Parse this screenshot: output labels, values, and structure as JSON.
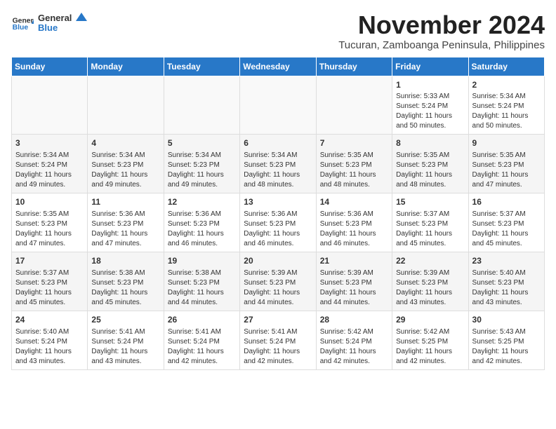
{
  "logo": {
    "line1": "General",
    "line2": "Blue"
  },
  "title": "November 2024",
  "location": "Tucuran, Zamboanga Peninsula, Philippines",
  "weekdays": [
    "Sunday",
    "Monday",
    "Tuesday",
    "Wednesday",
    "Thursday",
    "Friday",
    "Saturday"
  ],
  "weeks": [
    [
      {
        "day": "",
        "content": ""
      },
      {
        "day": "",
        "content": ""
      },
      {
        "day": "",
        "content": ""
      },
      {
        "day": "",
        "content": ""
      },
      {
        "day": "",
        "content": ""
      },
      {
        "day": "1",
        "content": "Sunrise: 5:33 AM\nSunset: 5:24 PM\nDaylight: 11 hours and 50 minutes."
      },
      {
        "day": "2",
        "content": "Sunrise: 5:34 AM\nSunset: 5:24 PM\nDaylight: 11 hours and 50 minutes."
      }
    ],
    [
      {
        "day": "3",
        "content": "Sunrise: 5:34 AM\nSunset: 5:24 PM\nDaylight: 11 hours and 49 minutes."
      },
      {
        "day": "4",
        "content": "Sunrise: 5:34 AM\nSunset: 5:23 PM\nDaylight: 11 hours and 49 minutes."
      },
      {
        "day": "5",
        "content": "Sunrise: 5:34 AM\nSunset: 5:23 PM\nDaylight: 11 hours and 49 minutes."
      },
      {
        "day": "6",
        "content": "Sunrise: 5:34 AM\nSunset: 5:23 PM\nDaylight: 11 hours and 48 minutes."
      },
      {
        "day": "7",
        "content": "Sunrise: 5:35 AM\nSunset: 5:23 PM\nDaylight: 11 hours and 48 minutes."
      },
      {
        "day": "8",
        "content": "Sunrise: 5:35 AM\nSunset: 5:23 PM\nDaylight: 11 hours and 48 minutes."
      },
      {
        "day": "9",
        "content": "Sunrise: 5:35 AM\nSunset: 5:23 PM\nDaylight: 11 hours and 47 minutes."
      }
    ],
    [
      {
        "day": "10",
        "content": "Sunrise: 5:35 AM\nSunset: 5:23 PM\nDaylight: 11 hours and 47 minutes."
      },
      {
        "day": "11",
        "content": "Sunrise: 5:36 AM\nSunset: 5:23 PM\nDaylight: 11 hours and 47 minutes."
      },
      {
        "day": "12",
        "content": "Sunrise: 5:36 AM\nSunset: 5:23 PM\nDaylight: 11 hours and 46 minutes."
      },
      {
        "day": "13",
        "content": "Sunrise: 5:36 AM\nSunset: 5:23 PM\nDaylight: 11 hours and 46 minutes."
      },
      {
        "day": "14",
        "content": "Sunrise: 5:36 AM\nSunset: 5:23 PM\nDaylight: 11 hours and 46 minutes."
      },
      {
        "day": "15",
        "content": "Sunrise: 5:37 AM\nSunset: 5:23 PM\nDaylight: 11 hours and 45 minutes."
      },
      {
        "day": "16",
        "content": "Sunrise: 5:37 AM\nSunset: 5:23 PM\nDaylight: 11 hours and 45 minutes."
      }
    ],
    [
      {
        "day": "17",
        "content": "Sunrise: 5:37 AM\nSunset: 5:23 PM\nDaylight: 11 hours and 45 minutes."
      },
      {
        "day": "18",
        "content": "Sunrise: 5:38 AM\nSunset: 5:23 PM\nDaylight: 11 hours and 45 minutes."
      },
      {
        "day": "19",
        "content": "Sunrise: 5:38 AM\nSunset: 5:23 PM\nDaylight: 11 hours and 44 minutes."
      },
      {
        "day": "20",
        "content": "Sunrise: 5:39 AM\nSunset: 5:23 PM\nDaylight: 11 hours and 44 minutes."
      },
      {
        "day": "21",
        "content": "Sunrise: 5:39 AM\nSunset: 5:23 PM\nDaylight: 11 hours and 44 minutes."
      },
      {
        "day": "22",
        "content": "Sunrise: 5:39 AM\nSunset: 5:23 PM\nDaylight: 11 hours and 43 minutes."
      },
      {
        "day": "23",
        "content": "Sunrise: 5:40 AM\nSunset: 5:23 PM\nDaylight: 11 hours and 43 minutes."
      }
    ],
    [
      {
        "day": "24",
        "content": "Sunrise: 5:40 AM\nSunset: 5:24 PM\nDaylight: 11 hours and 43 minutes."
      },
      {
        "day": "25",
        "content": "Sunrise: 5:41 AM\nSunset: 5:24 PM\nDaylight: 11 hours and 43 minutes."
      },
      {
        "day": "26",
        "content": "Sunrise: 5:41 AM\nSunset: 5:24 PM\nDaylight: 11 hours and 42 minutes."
      },
      {
        "day": "27",
        "content": "Sunrise: 5:41 AM\nSunset: 5:24 PM\nDaylight: 11 hours and 42 minutes."
      },
      {
        "day": "28",
        "content": "Sunrise: 5:42 AM\nSunset: 5:24 PM\nDaylight: 11 hours and 42 minutes."
      },
      {
        "day": "29",
        "content": "Sunrise: 5:42 AM\nSunset: 5:25 PM\nDaylight: 11 hours and 42 minutes."
      },
      {
        "day": "30",
        "content": "Sunrise: 5:43 AM\nSunset: 5:25 PM\nDaylight: 11 hours and 42 minutes."
      }
    ]
  ]
}
